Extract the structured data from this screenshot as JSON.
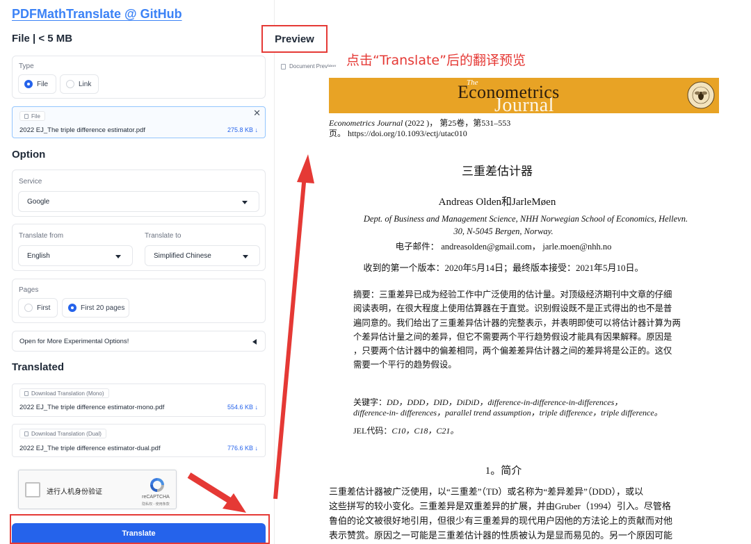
{
  "app": {
    "repo_link": "PDFMathTranslate @ GitHub"
  },
  "file_section": {
    "title": "File | < 5 MB",
    "type_label": "Type",
    "type_options": [
      "File",
      "Link"
    ],
    "type_selected": "File",
    "file_chip": "File",
    "file_name": "2022 EJ_The triple difference estimator.pdf",
    "file_size": "275.8 KB ↓"
  },
  "option_section": {
    "title": "Option",
    "service_label": "Service",
    "service_value": "Google",
    "from_label": "Translate from",
    "from_value": "English",
    "to_label": "Translate to",
    "to_value": "Simplified Chinese",
    "pages_label": "Pages",
    "pages_options": [
      "First",
      "First 20 pages"
    ],
    "pages_selected": "First 20 pages",
    "experimental_label": "Open for More Experimental Options!"
  },
  "translated_section": {
    "title": "Translated",
    "mono_chip": "Download Translation (Mono)",
    "mono_file": "2022 EJ_The triple difference estimator-mono.pdf",
    "mono_size": "554.6 KB ↓",
    "dual_chip": "Download Translation (Dual)",
    "dual_file": "2022 EJ_The triple difference estimator-dual.pdf",
    "dual_size": "776.6 KB ↓"
  },
  "captcha": {
    "text": "进行人机身份验证",
    "brand": "reCAPTCHA",
    "terms": "隐私权 - 使用条款"
  },
  "translate_button": "Translate",
  "preview": {
    "tab": "Preview",
    "label": "Document Preview",
    "annotation": "点击“Translate”后的翻译预览"
  },
  "document": {
    "banner_the": "The",
    "banner_econometrics": "Econometrics",
    "banner_journal": "Journal",
    "citation_journal": "Econometrics Journal",
    "citation_rest": " (2022 )， 第25卷，第531–553",
    "citation_line2": "页。 https://doi.org/10.1093/ectj/utac010",
    "title": "三重差估计器",
    "authors": "Andreas Olden和JarleMøen",
    "affiliation_1": "Dept. of Business and Management Science, NHH Norwegian School of Economics, Hellevn.",
    "affiliation_2": "30, N-5045 Bergen, Norway.",
    "email": "电子邮件： andreasolden@gmail.com， jarle.moen@nhh.no",
    "received": "收到的第一个版本：2020年5月14日；最终版本接受：2021年5月10日。",
    "abstract_lines": [
      "摘要：三重差异已成为经验工作中广泛使用的估计量。对顶级经济期刊中文章的仔细",
      "阅读表明，在很大程度上使用估算器在于直觉。识别假设既不是正式得出的也不是普",
      "遍同意的。我们给出了三重差异估计器的完整表示，并表明即使可以将估计器计算为两",
      "个差异估计量之间的差异，但它不需要两个平行趋势假设才能具有因果解释。原因是",
      "，只要两个估计器中的偏差相同，两个偏差差异估计器之间的差异将是公正的。这仅",
      "需要一个平行的趋势假设。"
    ],
    "keywords_label": "关键字：",
    "keywords_line1": "DD，DDD，DID，DiDiD，difference-in-difference-in-differences，",
    "keywords_line2": "difference-in- differences，parallel trend assumption，triple difference，triple difference。",
    "jel_label": "JEL代码：",
    "jel_codes": "C10，C18，C21。",
    "section_heading": "1。简介",
    "body_lines": [
      "三重差估计器被广泛使用，以“三重差”（TD）或名称为“差异差异”（DDD），或以",
      "这些拼写的较小变化。三重差异是双重差异的扩展，并由Gruber（1994）引入。尽管格",
      "鲁伯的论文被很好地引用，但很少有三重差异的现代用户因他的方法论上的贡献而对他",
      "表示赞赏。原因之一可能是三重差估计器的性质被认为是显而易见的。另一个原因可能"
    ]
  },
  "colors": {
    "accent": "#2563eb",
    "annotation_red": "#e53935",
    "banner_orange": "#e8a325"
  }
}
